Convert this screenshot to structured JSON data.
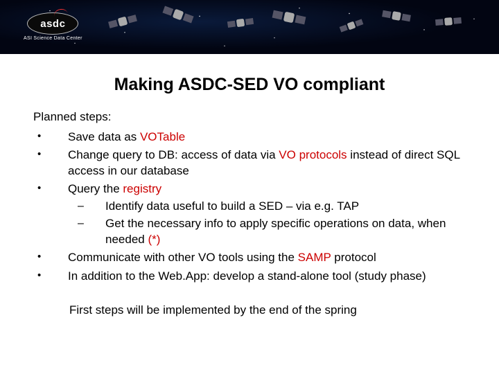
{
  "banner": {
    "logo_text": "asdc",
    "logo_subtitle": "ASI Science Data Center"
  },
  "title": "Making ASDC-SED VO compliant",
  "intro": "Planned steps:",
  "bullets": [
    {
      "pre": "Save data as ",
      "hl": "VOTable",
      "post": ""
    },
    {
      "pre": "Change query to DB: access of data via ",
      "hl": "VO protocols",
      "post": " instead of direct SQL access in our database"
    },
    {
      "pre": "Query the ",
      "hl": "registry",
      "post": "",
      "sub": [
        {
          "pre": "Identify data useful to build a SED – via e.g. TAP",
          "hl": "",
          "post": ""
        },
        {
          "pre": "Get the necessary info to apply specific operations on data, when needed ",
          "hl": "(*)",
          "post": ""
        }
      ]
    },
    {
      "pre": "Communicate with other VO tools using the ",
      "hl": "SAMP",
      "post": " protocol"
    },
    {
      "pre": "In addition to the Web.App:  develop a stand-alone tool (study phase)",
      "hl": "",
      "post": ""
    }
  ],
  "footer": "First steps will be implemented by the end of the spring"
}
